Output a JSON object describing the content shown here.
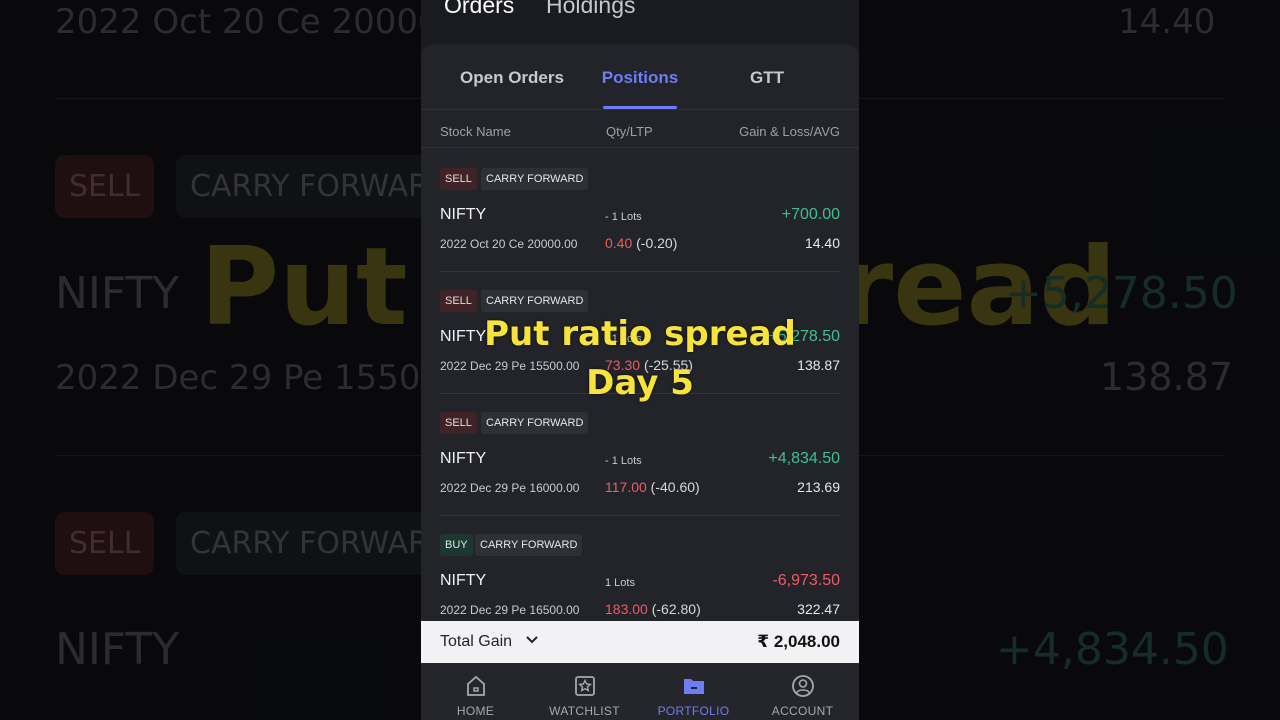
{
  "background": {
    "row1_contract": "2022 Oct 20 Ce 20000.",
    "row1_avg": "14.40",
    "sell1": "SELL",
    "cf1": "CARRY FORWAR",
    "nifty1": "NIFTY",
    "overlay_left": "Put",
    "overlay_right": "read",
    "gain2": "+5,278.50",
    "row2_contract": "2022 Dec 29 Pe 15500.0",
    "row2_avg": "138.87",
    "sell2": "SELL",
    "cf2": "CARRY FORWAR",
    "nifty2": "NIFTY",
    "gain3": "+4,834.50"
  },
  "header": {
    "tabs": [
      "Orders",
      "Holdings"
    ]
  },
  "subtabs": [
    {
      "label": "Open Orders",
      "active": false
    },
    {
      "label": "Positions",
      "active": true
    },
    {
      "label": "GTT",
      "active": false
    }
  ],
  "columns": {
    "stock": "Stock Name",
    "qty": "Qty/LTP",
    "gain": "Gain & Loss/AVG"
  },
  "positions": [
    {
      "side": "SELL",
      "product": "CARRY FORWARD",
      "name": "NIFTY",
      "qty": "- 1 Lots",
      "gain": "+700.00",
      "gain_sign": "pos",
      "contract": "2022 Oct 20 Ce 20000.00",
      "ltp": "0.40",
      "change": "(-0.20)",
      "avg": "14.40"
    },
    {
      "side": "SELL",
      "product": "CARRY FORWARD",
      "name": "NIFTY",
      "qty": "- 1 Lots",
      "gain": "+5,278.50",
      "gain_sign": "pos",
      "contract": "2022 Dec 29 Pe 15500.00",
      "ltp": "73.30",
      "change": "(-25.55)",
      "avg": "138.87"
    },
    {
      "side": "SELL",
      "product": "CARRY FORWARD",
      "name": "NIFTY",
      "qty": "- 1 Lots",
      "gain": "+4,834.50",
      "gain_sign": "pos",
      "contract": "2022 Dec 29 Pe 16000.00",
      "ltp": "117.00",
      "change": "(-40.60)",
      "avg": "213.69"
    },
    {
      "side": "BUY",
      "product": "CARRY FORWARD",
      "name": "NIFTY",
      "qty": "1 Lots",
      "gain": "-6,973.50",
      "gain_sign": "neg",
      "contract": "2022 Dec 29 Pe 16500.00",
      "ltp": "183.00",
      "change": "(-62.80)",
      "avg": "322.47"
    }
  ],
  "total": {
    "label": "Total Gain",
    "value": "₹ 2,048.00"
  },
  "nav": [
    {
      "label": "HOME",
      "icon": "home-icon",
      "active": false
    },
    {
      "label": "WATCHLIST",
      "icon": "star-icon",
      "active": false
    },
    {
      "label": "PORTFOLIO",
      "icon": "folder-icon",
      "active": true
    },
    {
      "label": "ACCOUNT",
      "icon": "user-icon",
      "active": false
    }
  ],
  "overlay": {
    "line1": "Put ratio spread",
    "line2": "Day 5"
  },
  "colors": {
    "accent": "#6f7cf3",
    "positive": "#3ec08e",
    "negative": "#ee5a66",
    "overlay_text": "#f6e33b"
  }
}
